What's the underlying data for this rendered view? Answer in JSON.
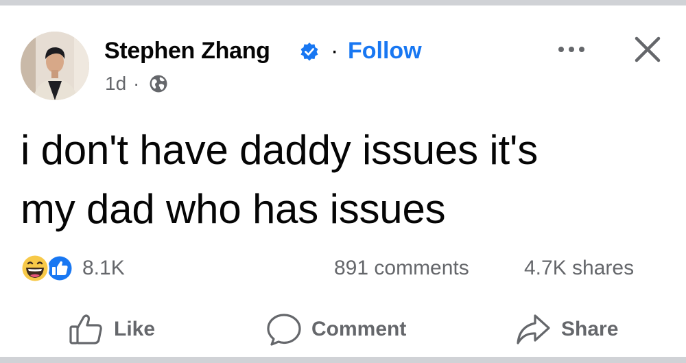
{
  "post": {
    "author": "Stephen Zhang",
    "separator": "·",
    "follow_label": "Follow",
    "time": "1d",
    "meta_separator": "·",
    "audience_icon": "globe-icon",
    "verified_icon": "verified-badge-icon",
    "text": "i don't have daddy issues it's\nmy dad who has issues"
  },
  "header_actions": {
    "more_icon": "more-options-icon",
    "close_icon": "close-icon"
  },
  "engagement": {
    "reaction_icons": [
      "haha-reaction-icon",
      "like-reaction-icon"
    ],
    "reaction_count": "8.1K",
    "comments": "891 comments",
    "shares": "4.7K shares"
  },
  "actions": [
    {
      "label": "Like",
      "icon": "thumbs-up-icon"
    },
    {
      "label": "Comment",
      "icon": "comment-bubble-icon"
    },
    {
      "label": "Share",
      "icon": "share-arrow-icon"
    }
  ],
  "colors": {
    "brand_blue": "#1877f2",
    "secondary_text": "#65676b",
    "primary_text": "#050505",
    "haha_yellow": "#f7c948"
  }
}
